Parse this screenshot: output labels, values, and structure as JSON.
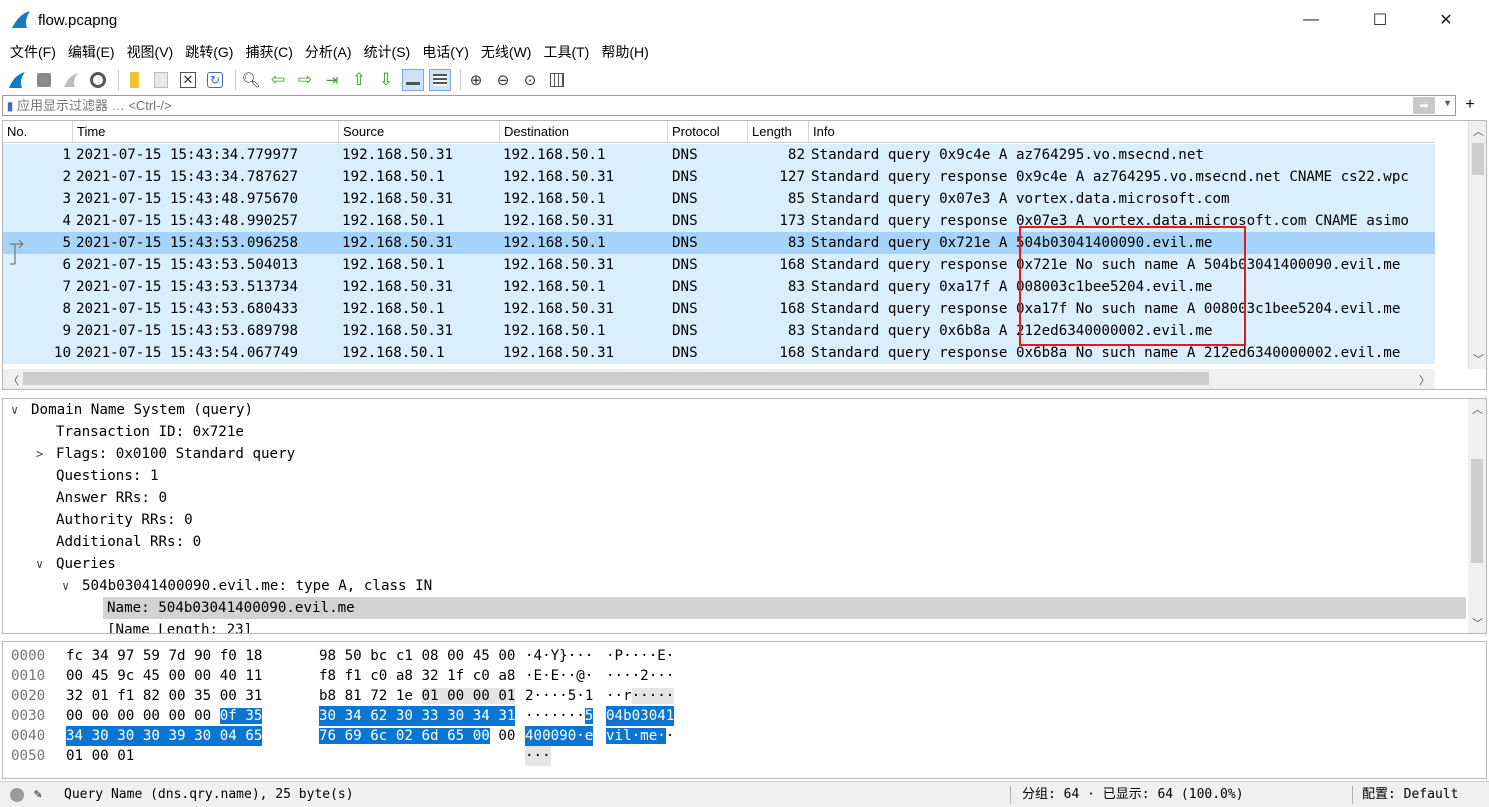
{
  "window": {
    "title": "flow.pcapng",
    "minimize": "—",
    "maximize": "☐",
    "close": "✕"
  },
  "menu": [
    "文件(F)",
    "编辑(E)",
    "视图(V)",
    "跳转(G)",
    "捕获(C)",
    "分析(A)",
    "统计(S)",
    "电话(Y)",
    "无线(W)",
    "工具(T)",
    "帮助(H)"
  ],
  "filter": {
    "placeholder": "应用显示过滤器 … <Ctrl-/>",
    "plus": "+"
  },
  "columns": [
    "No.",
    "Time",
    "Source",
    "Destination",
    "Protocol",
    "Length",
    "Info"
  ],
  "packets": [
    {
      "no": "1",
      "time": "2021-07-15 15:43:34.779977",
      "src": "192.168.50.31",
      "dst": "192.168.50.1",
      "proto": "DNS",
      "len": "82",
      "info": "Standard query 0x9c4e A az764295.vo.msecnd.net"
    },
    {
      "no": "2",
      "time": "2021-07-15 15:43:34.787627",
      "src": "192.168.50.1",
      "dst": "192.168.50.31",
      "proto": "DNS",
      "len": "127",
      "info": "Standard query response 0x9c4e A az764295.vo.msecnd.net CNAME cs22.wpc"
    },
    {
      "no": "3",
      "time": "2021-07-15 15:43:48.975670",
      "src": "192.168.50.31",
      "dst": "192.168.50.1",
      "proto": "DNS",
      "len": "85",
      "info": "Standard query 0x07e3 A vortex.data.microsoft.com"
    },
    {
      "no": "4",
      "time": "2021-07-15 15:43:48.990257",
      "src": "192.168.50.1",
      "dst": "192.168.50.31",
      "proto": "DNS",
      "len": "173",
      "info": "Standard query response 0x07e3 A vortex.data.microsoft.com CNAME asimo"
    },
    {
      "no": "5",
      "time": "2021-07-15 15:43:53.096258",
      "src": "192.168.50.31",
      "dst": "192.168.50.1",
      "proto": "DNS",
      "len": "83",
      "info": "Standard query 0x721e A 504b03041400090.evil.me"
    },
    {
      "no": "6",
      "time": "2021-07-15 15:43:53.504013",
      "src": "192.168.50.1",
      "dst": "192.168.50.31",
      "proto": "DNS",
      "len": "168",
      "info": "Standard query response 0x721e No such name A 504b03041400090.evil.me"
    },
    {
      "no": "7",
      "time": "2021-07-15 15:43:53.513734",
      "src": "192.168.50.31",
      "dst": "192.168.50.1",
      "proto": "DNS",
      "len": "83",
      "info": "Standard query 0xa17f A 008003c1bee5204.evil.me"
    },
    {
      "no": "8",
      "time": "2021-07-15 15:43:53.680433",
      "src": "192.168.50.1",
      "dst": "192.168.50.31",
      "proto": "DNS",
      "len": "168",
      "info": "Standard query response 0xa17f No such name A 008003c1bee5204.evil.me"
    },
    {
      "no": "9",
      "time": "2021-07-15 15:43:53.689798",
      "src": "192.168.50.31",
      "dst": "192.168.50.1",
      "proto": "DNS",
      "len": "83",
      "info": "Standard query 0x6b8a A 212ed6340000002.evil.me"
    },
    {
      "no": "10",
      "time": "2021-07-15 15:43:54.067749",
      "src": "192.168.50.1",
      "dst": "192.168.50.31",
      "proto": "DNS",
      "len": "168",
      "info": "Standard query response 0x6b8a No such name A 212ed6340000002.evil.me"
    }
  ],
  "selected_packet": "5",
  "details": [
    {
      "text": "Domain Name System (query)",
      "twisty": "∨"
    },
    {
      "text": "Transaction ID: 0x721e",
      "twisty": ""
    },
    {
      "text": "Flags: 0x0100 Standard query",
      "twisty": ">"
    },
    {
      "text": "Questions: 1",
      "twisty": ""
    },
    {
      "text": "Answer RRs: 0",
      "twisty": ""
    },
    {
      "text": "Authority RRs: 0",
      "twisty": ""
    },
    {
      "text": "Additional RRs: 0",
      "twisty": ""
    },
    {
      "text": "Queries",
      "twisty": "∨"
    },
    {
      "text": "504b03041400090.evil.me: type A, class IN",
      "twisty": "∨"
    },
    {
      "text": "Name: 504b03041400090.evil.me",
      "twisty": ""
    },
    {
      "text": "[Name Length: 23]",
      "twisty": ""
    }
  ],
  "bytes": [
    {
      "offset": "0000",
      "hex_a": "fc 34 97 59 7d 90 f0 18",
      "hex_b": "98 50 bc c1 08 00 45 00",
      "ascii_a": "·4·Y}···",
      "ascii_b": "·P····E·"
    },
    {
      "offset": "0010",
      "hex_a": "00 45 9c 45 00 00 40 11",
      "hex_b": "f8 f1 c0 a8 32 1f c0 a8",
      "ascii_a": "·E·E··@·",
      "ascii_b": "····2···"
    },
    {
      "offset": "0020",
      "hex_a": "32 01 f1 82 00 35 00 31",
      "hex_b": "b8 81 72 1e 01 00 00 01",
      "ascii_a": "2····5·1",
      "ascii_b": "··r·····"
    },
    {
      "offset": "0030",
      "hex_a": "00 00 00 00 00 00 0f 35",
      "hex_b": "30 34 62 30 33 30 34 31",
      "ascii_a": "·······5",
      "ascii_b": "04b03041"
    },
    {
      "offset": "0040",
      "hex_a": "34 30 30 30 39 30 04 65",
      "hex_b": "76 69 6c 02 6d 65 00 00",
      "ascii_a": "400090·e",
      "ascii_b": "vil·me··"
    },
    {
      "offset": "0050",
      "hex_a": "01 00 01",
      "hex_b": "",
      "ascii_a": "···",
      "ascii_b": ""
    }
  ],
  "status": {
    "field": "Query Name (dns.qry.name), 25 byte(s)",
    "packets": "分组: 64 · 已显示: 64 (100.0%)",
    "profile": "配置: Default"
  },
  "colors": {
    "row_bg": "#daeefc",
    "row_selected": "#a6d3f9",
    "byte_highlight": "#0a76d1",
    "annotation_box": "#e01c1c"
  }
}
